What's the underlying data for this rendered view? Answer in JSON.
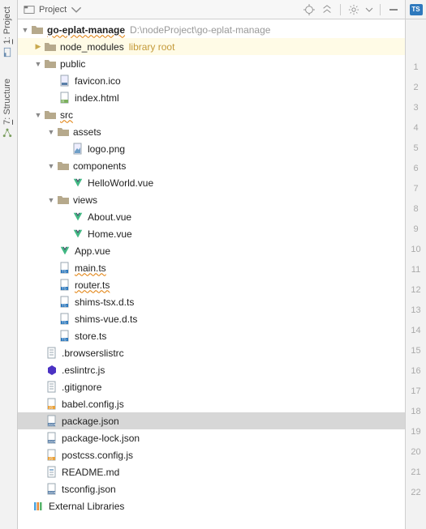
{
  "sidebar_tabs": {
    "project": {
      "num": "1",
      "label": "Project"
    },
    "structure": {
      "num": "7",
      "label": "Structure"
    }
  },
  "toolbar": {
    "selector_label": "Project"
  },
  "gutter": {
    "lines": [
      "1",
      "2",
      "3",
      "4",
      "5",
      "6",
      "7",
      "8",
      "9",
      "10",
      "11",
      "12",
      "13",
      "14",
      "15",
      "16",
      "17",
      "18",
      "19",
      "20",
      "21",
      "22"
    ]
  },
  "tree": {
    "root": {
      "name": "go-eplat-manage",
      "path": "D:\\nodeProject\\go-eplat-manage"
    },
    "node_modules": {
      "name": "node_modules",
      "hint": "library root"
    },
    "public": {
      "name": "public"
    },
    "favicon": "favicon.ico",
    "index_html": "index.html",
    "src": {
      "name": "src"
    },
    "assets": {
      "name": "assets"
    },
    "logo_png": "logo.png",
    "components": {
      "name": "components"
    },
    "hello_world": "HelloWorld.vue",
    "views": {
      "name": "views"
    },
    "about_vue": "About.vue",
    "home_vue": "Home.vue",
    "app_vue": "App.vue",
    "main_ts": "main.ts",
    "router_ts": "router.ts",
    "shims_tsx": "shims-tsx.d.ts",
    "shims_vue": "shims-vue.d.ts",
    "store_ts": "store.ts",
    "browserslist": ".browserslistrc",
    "eslintrc": ".eslintrc.js",
    "gitignore": ".gitignore",
    "babel_config": "babel.config.js",
    "package_json": "package.json",
    "package_lock": "package-lock.json",
    "postcss_config": "postcss.config.js",
    "readme": "README.md",
    "tsconfig": "tsconfig.json",
    "external_libs": "External Libraries"
  }
}
